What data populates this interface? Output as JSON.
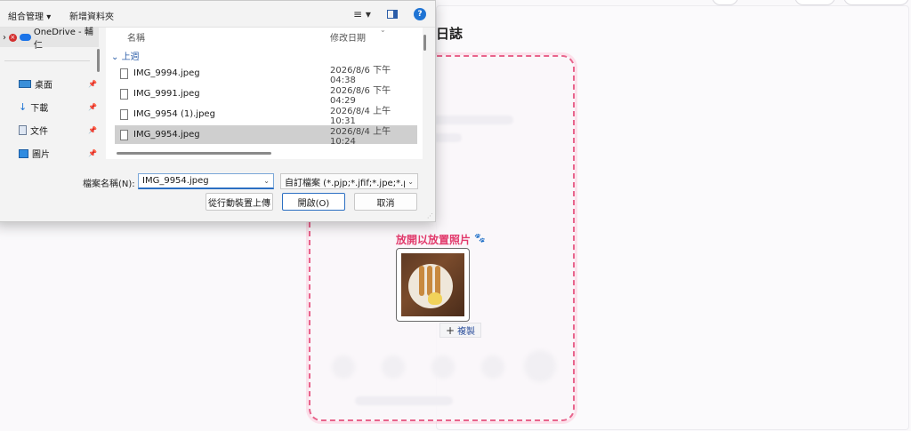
{
  "page": {
    "title_fragment": "語日誌",
    "drop_hint": "放開以放置照片",
    "copy_badge": "複製"
  },
  "dialog": {
    "toolbar": {
      "organize": "組合管理",
      "new_folder": "新增資料夾"
    },
    "nav": {
      "onedrive": "OneDrive - 輔仁",
      "items": [
        {
          "label": "桌面"
        },
        {
          "label": "下載"
        },
        {
          "label": "文件"
        },
        {
          "label": "圖片"
        }
      ]
    },
    "columns": {
      "name": "名稱",
      "date": "修改日期"
    },
    "group_title": "上週",
    "files": [
      {
        "name": "IMG_9994.jpeg",
        "date": "2026/8/6 下午 04:38"
      },
      {
        "name": "IMG_9991.jpeg",
        "date": "2026/8/6 下午 04:29"
      },
      {
        "name": "IMG_9954 (1).jpeg",
        "date": "2026/8/4 上午 10:31"
      },
      {
        "name": "IMG_9954.jpeg",
        "date": "2026/8/4 上午 10:24"
      }
    ],
    "filename_label": "檔案名稱(N):",
    "filename_value": "IMG_9954.jpeg",
    "filetype_value": "自訂檔案 (*.pjp;*.jfif;*.jpe;*.pjpeg",
    "buttons": {
      "device_upload": "從行動裝置上傳",
      "open": "開啟(O)",
      "cancel": "取消"
    }
  },
  "colors": {
    "accent": "#e23a6c",
    "dialog_primary": "#2b6fc2",
    "selected_row": "#cfcfcf"
  }
}
